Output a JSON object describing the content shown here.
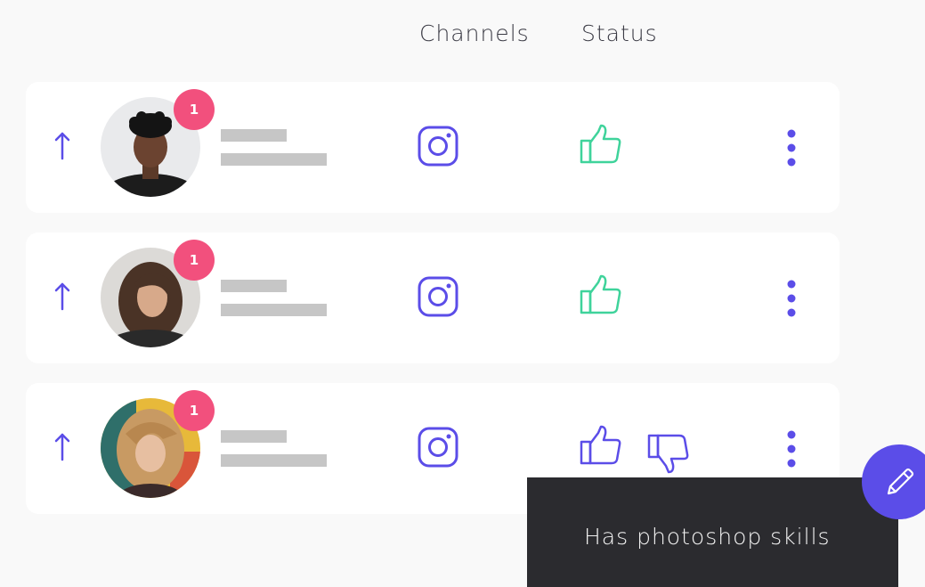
{
  "header": {
    "channels_label": "Channels",
    "status_label": "Status"
  },
  "rows": [
    {
      "badge_count": "1",
      "channel_icon": "instagram-icon",
      "status_icons": [
        "thumbs-up-icon"
      ],
      "status_color": "#3fd39b"
    },
    {
      "badge_count": "1",
      "channel_icon": "instagram-icon",
      "status_icons": [
        "thumbs-up-icon"
      ],
      "status_color": "#3fd39b"
    },
    {
      "badge_count": "1",
      "channel_icon": "instagram-icon",
      "status_icons": [
        "thumbs-up-icon",
        "thumbs-down-icon"
      ],
      "status_color": "#5b4de8"
    }
  ],
  "tooltip": {
    "text": "Has photoshop skills"
  },
  "fab": {
    "icon": "pencil-icon"
  },
  "colors": {
    "accent": "#5b4de8",
    "badge": "#f2507d",
    "approved": "#3fd39b",
    "tooltip_bg": "#2b2b2f",
    "placeholder_bar": "#c6c6c6"
  }
}
